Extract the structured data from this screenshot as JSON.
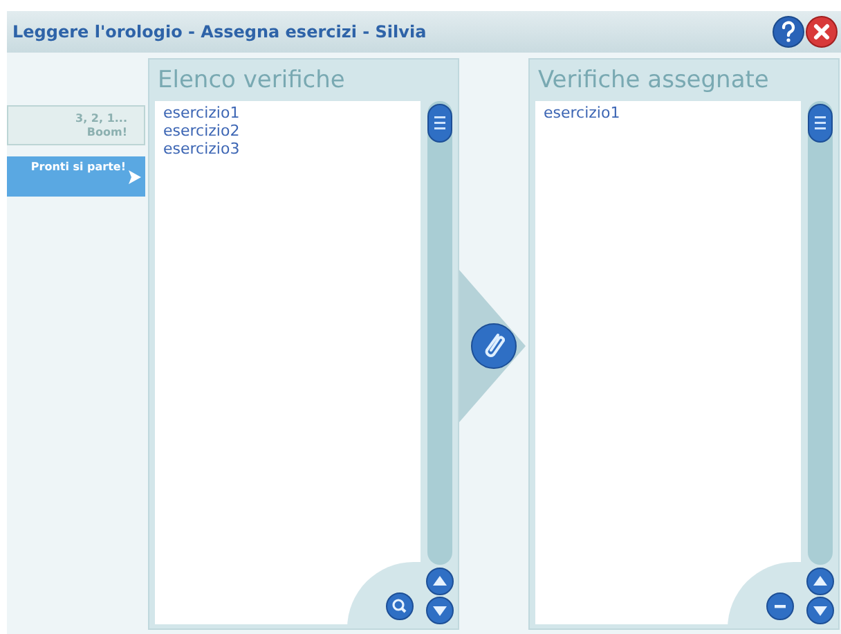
{
  "window": {
    "title": "Leggere l'orologio - Assegna esercizi - Silvia"
  },
  "sidebar": {
    "items": [
      {
        "label": "3, 2, 1... Boom!",
        "selected": false
      },
      {
        "label": "Pronti si parte!",
        "selected": true
      }
    ]
  },
  "available_list": {
    "title": "Elenco verifiche",
    "items": [
      "esercizio1",
      "esercizio2",
      "esercizio3"
    ]
  },
  "assigned_list": {
    "title": "Verifiche assegnate",
    "items": [
      "esercizio1"
    ]
  }
}
